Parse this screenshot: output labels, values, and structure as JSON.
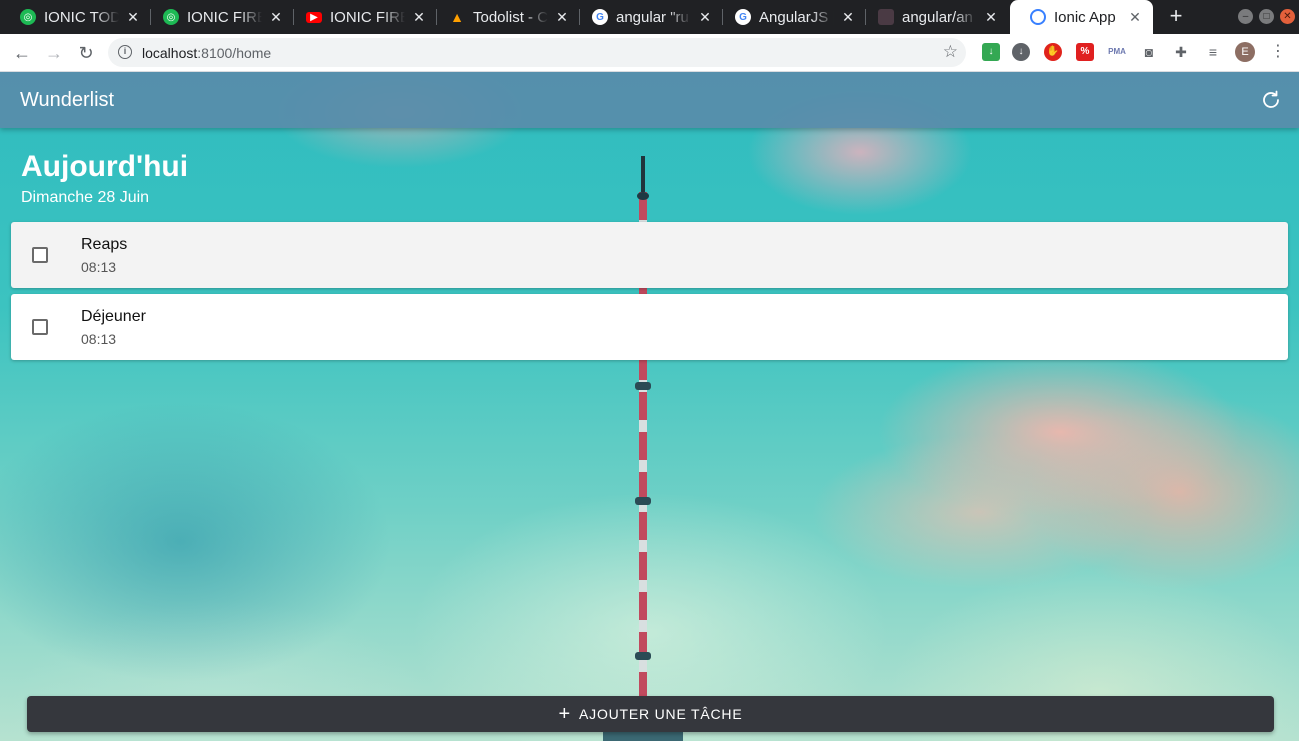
{
  "browser": {
    "tabs": [
      {
        "title": "IONIC TODO",
        "favicon": "green-circle-icon",
        "color": "#1db954"
      },
      {
        "title": "IONIC FIREB",
        "favicon": "green-circle-icon",
        "color": "#1db954"
      },
      {
        "title": "IONIC FIREB",
        "favicon": "youtube-icon",
        "color": "#ff0000"
      },
      {
        "title": "Todolist - Co",
        "favicon": "firebase-icon",
        "color": "#ffa000"
      },
      {
        "title": "angular \"ru",
        "favicon": "google-icon",
        "color": "#4285f4"
      },
      {
        "title": "AngularJS |",
        "favicon": "google-icon",
        "color": "#4285f4"
      },
      {
        "title": "angular/an",
        "favicon": "github-icon",
        "color": "#4a3a44"
      },
      {
        "title": "Ionic App",
        "favicon": "ionic-icon",
        "color": "#3880ff"
      }
    ],
    "url_host": "localhost",
    "url_path": ":8100/home"
  },
  "app": {
    "title": "Wunderlist",
    "day_title": "Aujourd'hui",
    "day_date": "Dimanche 28 Juin",
    "tasks": [
      {
        "name": "Reaps",
        "time": "08:13",
        "checked": false
      },
      {
        "name": "Déjeuner",
        "time": "08:13",
        "checked": false
      }
    ],
    "add_button_label": "AJOUTER UNE TÂCHE"
  }
}
